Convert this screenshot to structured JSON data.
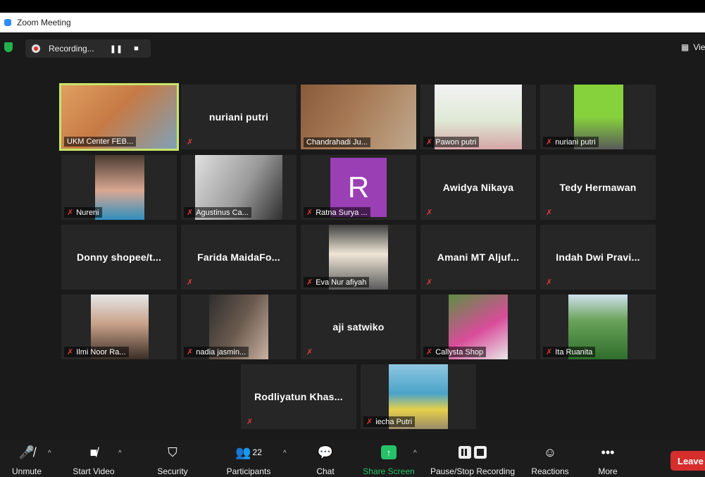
{
  "window": {
    "title": "Zoom Meeting"
  },
  "recording": {
    "label": "Recording...",
    "pause_glyph": "❚❚",
    "stop_glyph": "■"
  },
  "view": {
    "label": "Vie"
  },
  "tiles": [
    {
      "name": "UKM Center FEB...",
      "type": "video",
      "active": true,
      "colors": [
        "#d89a5a",
        "#8aa6b8"
      ]
    },
    {
      "name": "nuriani putri",
      "type": "text"
    },
    {
      "name": "Chandrahadi Ju...",
      "type": "video",
      "colors": [
        "#8a5a3b",
        "#c0a98e"
      ]
    },
    {
      "name": "Pawon putri",
      "type": "video",
      "colors": [
        "#e8e8e8",
        "#6b9c4a"
      ]
    },
    {
      "name": "nuriani putri",
      "type": "video",
      "colors": [
        "#7fcf3a",
        "#3b3b3b"
      ]
    },
    {
      "name": "Nureni",
      "type": "video",
      "colors": [
        "#5d4a3e",
        "#e3b09a"
      ]
    },
    {
      "name": "Agustinus Ca...",
      "type": "video",
      "colors": [
        "#d7d7d7",
        "#3a3a3a"
      ]
    },
    {
      "name": "Ratna Surya ...",
      "type": "avatar",
      "initial": "R"
    },
    {
      "name": "Awidya Nikaya",
      "type": "text"
    },
    {
      "name": "Tedy Hermawan",
      "type": "text"
    },
    {
      "name": "Donny shopee/t...",
      "type": "text"
    },
    {
      "name": "Farida MaidaFo...",
      "type": "text"
    },
    {
      "name": "Eva Nur afiyah",
      "type": "video",
      "colors": [
        "#4f4f4f",
        "#f0e8dc"
      ]
    },
    {
      "name": "Amani MT Aljuf...",
      "type": "text"
    },
    {
      "name": "Indah Dwi Pravi...",
      "type": "text"
    },
    {
      "name": "Ilmi Noor Ra...",
      "type": "video",
      "colors": [
        "#dcdcdc",
        "#4a3a2e"
      ]
    },
    {
      "name": "nadia jasmin...",
      "type": "video",
      "colors": [
        "#3d3d3d",
        "#b89b86"
      ]
    },
    {
      "name": "aji satwiko",
      "type": "text"
    },
    {
      "name": "Callysta Shop",
      "type": "video",
      "colors": [
        "#6b9c4a",
        "#d94c9a"
      ]
    },
    {
      "name": "Ita Ruanita",
      "type": "video",
      "colors": [
        "#3f8a3a",
        "#bcd6e8"
      ]
    },
    {
      "name": "Rodliyatun Khas...",
      "type": "text"
    },
    {
      "name": "iecha Putri",
      "type": "video",
      "colors": [
        "#4aa3c9",
        "#e6d04a"
      ]
    }
  ],
  "toolbar": {
    "unmute": "Unmute",
    "start_video": "Start Video",
    "security": "Security",
    "participants": "Participants",
    "participants_count": "22",
    "chat": "Chat",
    "share_screen": "Share Screen",
    "pause_stop": "Pause/Stop Recording",
    "reactions": "Reactions",
    "more": "More",
    "leave": "Leave"
  },
  "colors": {
    "accent_green": "#26c26a",
    "leave_red": "#d62d2d",
    "muted_red": "#e03b3b",
    "active_speaker": "#c9e46a"
  }
}
